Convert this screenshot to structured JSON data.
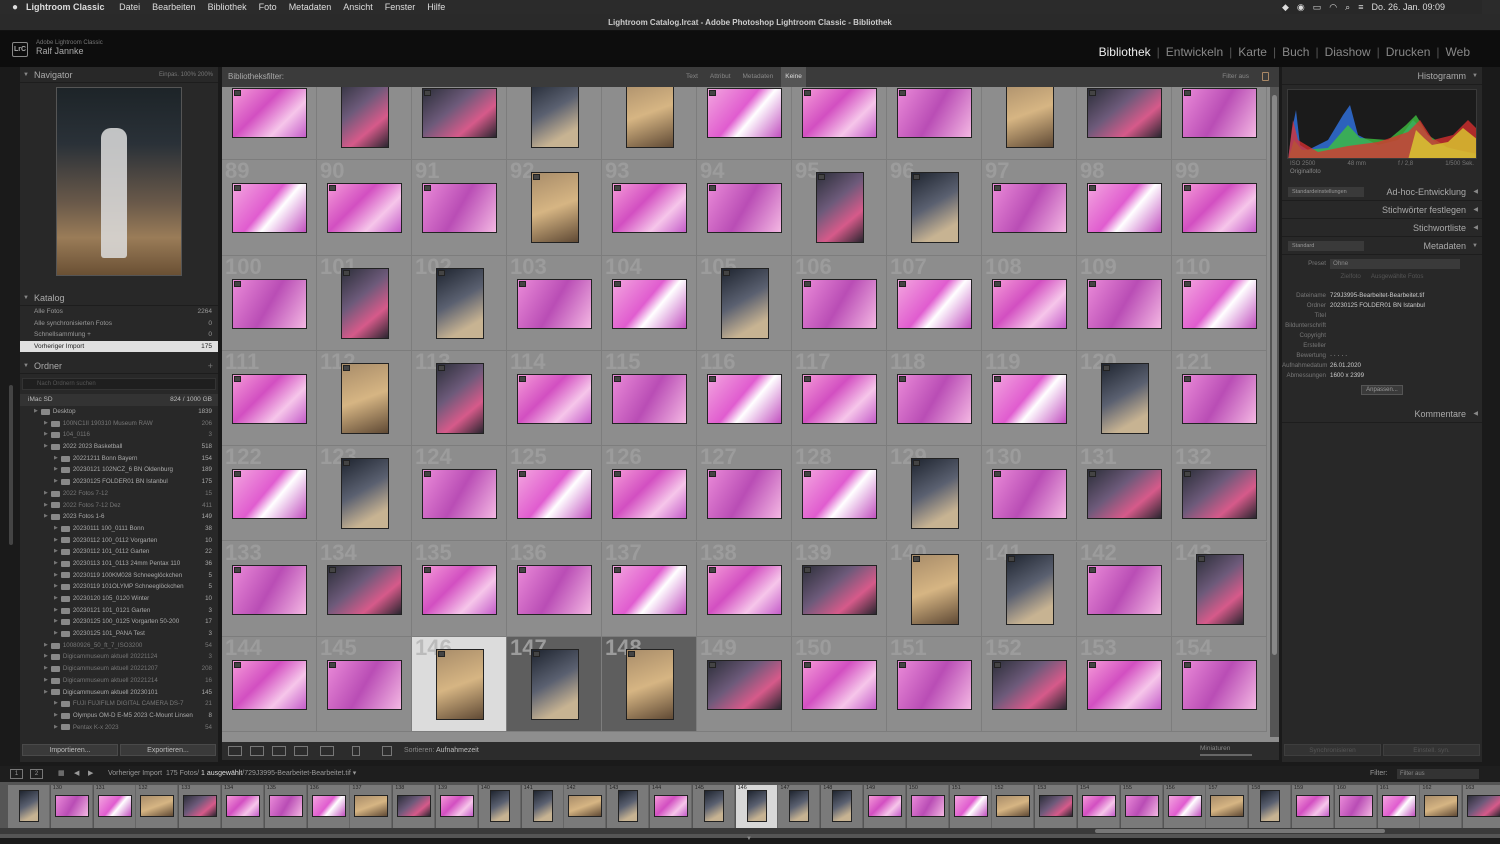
{
  "mac_menu": {
    "app": "Lightroom Classic",
    "items": [
      "Datei",
      "Bearbeiten",
      "Bibliothek",
      "Foto",
      "Metadaten",
      "Ansicht",
      "Fenster",
      "Hilfe"
    ],
    "clock": "Do. 26. Jan. 09:09"
  },
  "window_title": "Lightroom Catalog.lrcat - Adobe Photoshop Lightroom Classic - Bibliothek",
  "identity": {
    "logo": "LrC",
    "product": "Adobe Lightroom Classic",
    "user": "Ralf Jannke"
  },
  "modules": [
    "Bibliothek",
    "Entwickeln",
    "Karte",
    "Buch",
    "Diashow",
    "Drucken",
    "Web"
  ],
  "active_module": "Bibliothek",
  "navigator": {
    "title": "Navigator",
    "zoom_options": "Einpas.  100%  200%"
  },
  "catalog": {
    "title": "Katalog",
    "rows": [
      {
        "label": "Alle Fotos",
        "count": "2264"
      },
      {
        "label": "Alle synchronisierten Fotos",
        "count": "0"
      },
      {
        "label": "Schnellsammlung +",
        "count": "0"
      },
      {
        "label": "Vorheriger Import",
        "count": "175"
      }
    ]
  },
  "folders": {
    "title": "Ordner",
    "search_placeholder": "Nach Ordnern suchen",
    "volume": {
      "name": "iMac SD",
      "space": "824 / 1000 GB"
    },
    "rows": [
      {
        "label": "Desktop",
        "count": "1839",
        "dim": false
      },
      {
        "label": "100NC1II 190310 Museum RAW",
        "count": "206",
        "dim": true
      },
      {
        "label": "104_0116",
        "count": "3",
        "dim": true
      },
      {
        "label": "2022 2023 Basketball",
        "count": "518",
        "dim": false
      },
      {
        "label": "20221211 Bonn Bayern",
        "count": "154",
        "dim": false
      },
      {
        "label": "20230121 102NCZ_6 BN Oldenburg",
        "count": "189",
        "dim": false
      },
      {
        "label": "20230125 FOLDER01 BN Istanbul",
        "count": "175",
        "dim": false
      },
      {
        "label": "2022 Fotos 7-12",
        "count": "15",
        "dim": true
      },
      {
        "label": "2022 Fotos 7-12 Dez",
        "count": "411",
        "dim": true
      },
      {
        "label": "2023 Fotos 1-6",
        "count": "149",
        "dim": false
      },
      {
        "label": "20230111 100_0111 Bonn",
        "count": "38",
        "dim": false
      },
      {
        "label": "20230112 100_0112 Vorgarten",
        "count": "10",
        "dim": false
      },
      {
        "label": "20230112 101_0112 Garten",
        "count": "22",
        "dim": false
      },
      {
        "label": "20230113 101_0113 24mm Pentax 110",
        "count": "36",
        "dim": false
      },
      {
        "label": "20230119 100KM028 Schneeglöckchen",
        "count": "5",
        "dim": false
      },
      {
        "label": "20230119 101OLYMP Schneeglöckchen",
        "count": "5",
        "dim": false
      },
      {
        "label": "20230120 105_0120 Winter",
        "count": "10",
        "dim": false
      },
      {
        "label": "20230121 101_0121 Garten",
        "count": "3",
        "dim": false
      },
      {
        "label": "20230125 100_0125 Vorgarten 50-200",
        "count": "17",
        "dim": false
      },
      {
        "label": "20230125 101_PANA Test",
        "count": "3",
        "dim": false
      },
      {
        "label": "10080926_50_ft_7_ISO3200",
        "count": "54",
        "dim": true
      },
      {
        "label": "Digicammuseum aktuell 20221124",
        "count": "3",
        "dim": true
      },
      {
        "label": "Digicammuseum aktuell 20221207",
        "count": "208",
        "dim": true
      },
      {
        "label": "Digicammuseum aktuell 20221214",
        "count": "16",
        "dim": true
      },
      {
        "label": "Digicammuseum aktuell 20230101",
        "count": "145",
        "dim": false
      },
      {
        "label": "FUJI FUJIFILM DIGITAL CAMERA DS-7",
        "count": "21",
        "dim": true
      },
      {
        "label": "Olympus OM-D E-M5 2023 C-Mount Linsen",
        "count": "8",
        "dim": false
      },
      {
        "label": "Pentax K-x 2023",
        "count": "54",
        "dim": true
      }
    ]
  },
  "left_buttons": {
    "import": "Importieren...",
    "export": "Exportieren..."
  },
  "filterbar": {
    "title": "Bibliotheksfilter:",
    "options": [
      "Text",
      "Attribut",
      "Metadaten",
      "Keine"
    ],
    "active": "Keine",
    "right": "Filter aus"
  },
  "grid_numbers": [
    "",
    "",
    "",
    "",
    "",
    "",
    "",
    "",
    "",
    "",
    "",
    "89",
    "90",
    "91",
    "92",
    "93",
    "94",
    "95",
    "96",
    "97",
    "98",
    "99",
    "100",
    "101",
    "102",
    "103",
    "104",
    "105",
    "106",
    "107",
    "108",
    "109",
    "110",
    "111",
    "112",
    "113",
    "114",
    "115",
    "116",
    "117",
    "118",
    "119",
    "120",
    "121",
    "122",
    "123",
    "124",
    "125",
    "126",
    "127",
    "128",
    "129",
    "130",
    "131",
    "132",
    "133",
    "134",
    "135",
    "136",
    "137",
    "138",
    "139",
    "140",
    "141",
    "142",
    "143",
    "144",
    "145",
    "146",
    "147",
    "148",
    "149",
    "150",
    "151",
    "152",
    "153",
    "154"
  ],
  "toolbar": {
    "sort_label": "Sortieren:",
    "sort_value": "Aufnahmezeit",
    "mini_label": "Miniaturen"
  },
  "histogram": {
    "title": "Histogramm",
    "iso": "ISO 2500",
    "focal": "48 mm",
    "aperture": "f / 2,8",
    "shutter": "1/500 Sek.",
    "original": "Originalfoto"
  },
  "right_panels": {
    "quick_develop": "Ad-hoc-Entwicklung",
    "quick_preset": "Standardeinstellungen",
    "keywording": "Stichwörter festlegen",
    "keyword_list": "Stichwortliste",
    "metadata": "Metadaten",
    "metadata_preset_select": "Standard",
    "comments": "Kommentare"
  },
  "metadata": {
    "preset_label": "Preset",
    "preset_value": "Ohne",
    "tabs": [
      "Zielfoto",
      "Ausgewählte Fotos"
    ],
    "fields": [
      {
        "k": "Dateiname",
        "v": "729J3995-Bearbeitet-Bearbeitet.tif"
      },
      {
        "k": "Ordner",
        "v": "20230125 FOLDER01 BN Istanbul"
      },
      {
        "k": "Titel",
        "v": ""
      },
      {
        "k": "Bildunterschrift",
        "v": ""
      },
      {
        "k": "Copyright",
        "v": ""
      },
      {
        "k": "Ersteller",
        "v": ""
      },
      {
        "k": "Bewertung",
        "v": "· · · · ·"
      },
      {
        "k": "Aufnahmedatum",
        "v": "26.01.2020"
      },
      {
        "k": "Abmessungen",
        "v": "1600 x 2399"
      }
    ],
    "customize_button": "Anpassen..."
  },
  "right_buttons": {
    "sync_meta": "Synchronisieren",
    "sync_settings": "Einstell. syn."
  },
  "filmstrip_bar": {
    "screen1": "1",
    "screen2": "2",
    "source": "Vorheriger Import",
    "count": "175 Fotos/",
    "selected": "1 ausgewählt",
    "file": "/729J3995-Bearbeitet-Bearbeitet.tif ▾",
    "filter_label": "Filter:",
    "filter_value": "Filter aus"
  },
  "filmstrip_numbers": [
    "",
    "130",
    "131",
    "132",
    "133",
    "134",
    "135",
    "136",
    "137",
    "138",
    "139",
    "140",
    "141",
    "142",
    "143",
    "144",
    "145",
    "146",
    "147",
    "148",
    "149",
    "150",
    "151",
    "152",
    "153",
    "154",
    "155",
    "156",
    "157",
    "158",
    "159",
    "160",
    "161",
    "162",
    "163"
  ],
  "colors": {
    "pink": "#e040c8",
    "lightpink": "#f0a0e0",
    "gridbg": "#8e8e8e",
    "selected": "#dcdcdc"
  }
}
